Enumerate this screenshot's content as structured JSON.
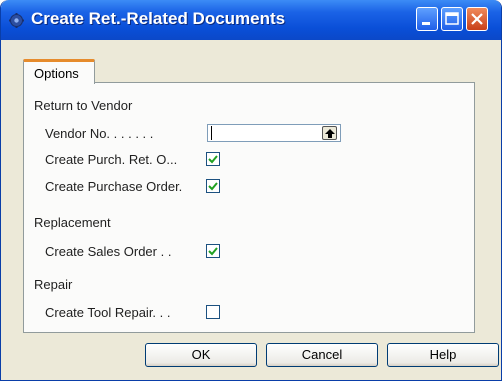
{
  "window": {
    "title": "Create Ret.-Related Documents",
    "icon": "app-gear-icon",
    "controls": [
      "minimize-icon",
      "maximize-icon",
      "close-icon"
    ]
  },
  "tabs": [
    {
      "label": "Options",
      "active": true
    }
  ],
  "groups": {
    "return_to_vendor": {
      "title": "Return to Vendor",
      "vendor_no": {
        "label": "Vendor No. . . . . . .",
        "value": "",
        "lookup_icon": "up-arrow-lookup-icon"
      },
      "create_purch_ret": {
        "label": "Create Purch. Ret. O...",
        "checked": true
      },
      "create_purchase_order": {
        "label": "Create Purchase Order.",
        "checked": true
      }
    },
    "replacement": {
      "title": "Replacement",
      "create_sales_order": {
        "label": "Create Sales Order . .",
        "checked": true
      }
    },
    "repair": {
      "title": "Repair",
      "create_tool_repair": {
        "label": "Create Tool Repair. . .",
        "checked": false
      }
    }
  },
  "buttons": {
    "ok": "OK",
    "cancel": "Cancel",
    "help": "Help"
  },
  "colors": {
    "title_bar": "#0a4fd8",
    "check_mark": "#21a121",
    "tab_accent": "#e68b2c"
  }
}
